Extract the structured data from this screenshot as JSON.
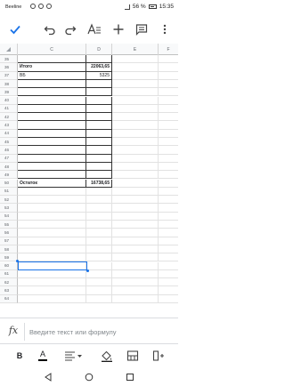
{
  "status_bar": {
    "carrier": "Beeline",
    "battery": "56 %",
    "time": "15:35"
  },
  "toolbar": {
    "icons": [
      "check-icon",
      "undo-icon",
      "redo-icon",
      "text-format-icon",
      "plus-icon",
      "comment-icon",
      "more-icon"
    ]
  },
  "columns": [
    "",
    "C",
    "D",
    "E",
    "F"
  ],
  "rows": [
    {
      "num": "35",
      "c": "",
      "d": "",
      "bold": false
    },
    {
      "num": "36",
      "c": "Итого",
      "d": "22063,65",
      "bold": true
    },
    {
      "num": "37",
      "c": "ВБ",
      "d": "5325",
      "bold": false
    },
    {
      "num": "38",
      "c": "",
      "d": "",
      "bold": false
    },
    {
      "num": "39",
      "c": "",
      "d": "",
      "bold": false
    },
    {
      "num": "40",
      "c": "",
      "d": "",
      "bold": false
    },
    {
      "num": "41",
      "c": "",
      "d": "",
      "bold": false
    },
    {
      "num": "42",
      "c": "",
      "d": "",
      "bold": false
    },
    {
      "num": "43",
      "c": "",
      "d": "",
      "bold": false
    },
    {
      "num": "44",
      "c": "",
      "d": "",
      "bold": false
    },
    {
      "num": "45",
      "c": "",
      "d": "",
      "bold": false
    },
    {
      "num": "46",
      "c": "",
      "d": "",
      "bold": false
    },
    {
      "num": "47",
      "c": "",
      "d": "",
      "bold": false
    },
    {
      "num": "48",
      "c": "",
      "d": "",
      "bold": false
    },
    {
      "num": "49",
      "c": "",
      "d": "",
      "bold": false
    },
    {
      "num": "50",
      "c": "Остаток",
      "d": "16738,65",
      "bold": true
    },
    {
      "num": "51",
      "c": "",
      "d": "",
      "bold": false
    },
    {
      "num": "52",
      "c": "",
      "d": "",
      "bold": false
    },
    {
      "num": "53",
      "c": "",
      "d": "",
      "bold": false
    },
    {
      "num": "54",
      "c": "",
      "d": "",
      "bold": false
    },
    {
      "num": "55",
      "c": "",
      "d": "",
      "bold": false
    },
    {
      "num": "56",
      "c": "",
      "d": "",
      "bold": false
    },
    {
      "num": "57",
      "c": "",
      "d": "",
      "bold": false
    },
    {
      "num": "58",
      "c": "",
      "d": "",
      "bold": false
    },
    {
      "num": "59",
      "c": "",
      "d": "",
      "bold": false
    },
    {
      "num": "60",
      "c": "",
      "d": "",
      "bold": false
    },
    {
      "num": "61",
      "c": "",
      "d": "",
      "bold": false
    },
    {
      "num": "62",
      "c": "",
      "d": "",
      "bold": false
    },
    {
      "num": "63",
      "c": "",
      "d": "",
      "bold": false
    },
    {
      "num": "64",
      "c": "",
      "d": "",
      "bold": false
    }
  ],
  "formula_bar": {
    "icon": "fx",
    "placeholder": "Введите текст или формулу"
  },
  "format_bar": {
    "bold_label": "B",
    "text_color_label": "A"
  },
  "colors": {
    "accent": "#1a73e8"
  }
}
